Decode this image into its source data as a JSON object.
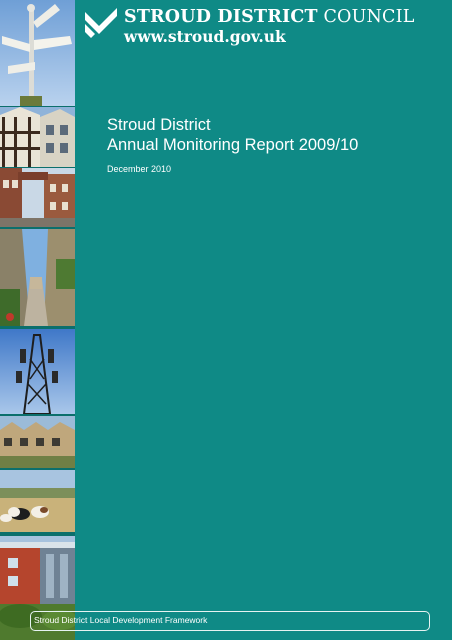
{
  "header": {
    "council_name_bold": "STROUD DISTRICT",
    "council_name_regular": "COUNCIL",
    "website": "www.stroud.gov.uk"
  },
  "document": {
    "title_line1": "Stroud District",
    "title_line2": "Annual Monitoring Report 2009/10",
    "date": "December 2010"
  },
  "footer": {
    "label": "Stroud District Local Development Framework"
  },
  "images": [
    "signpost-photo",
    "tudor-houses-photo",
    "brick-archway-street-photo",
    "narrow-lane-photo",
    "telecom-mast-photo",
    "stone-manor-house-photo",
    "cows-field-photo",
    "modern-building-photo"
  ],
  "colors": {
    "background": "#0f8a86",
    "text": "#ffffff"
  }
}
